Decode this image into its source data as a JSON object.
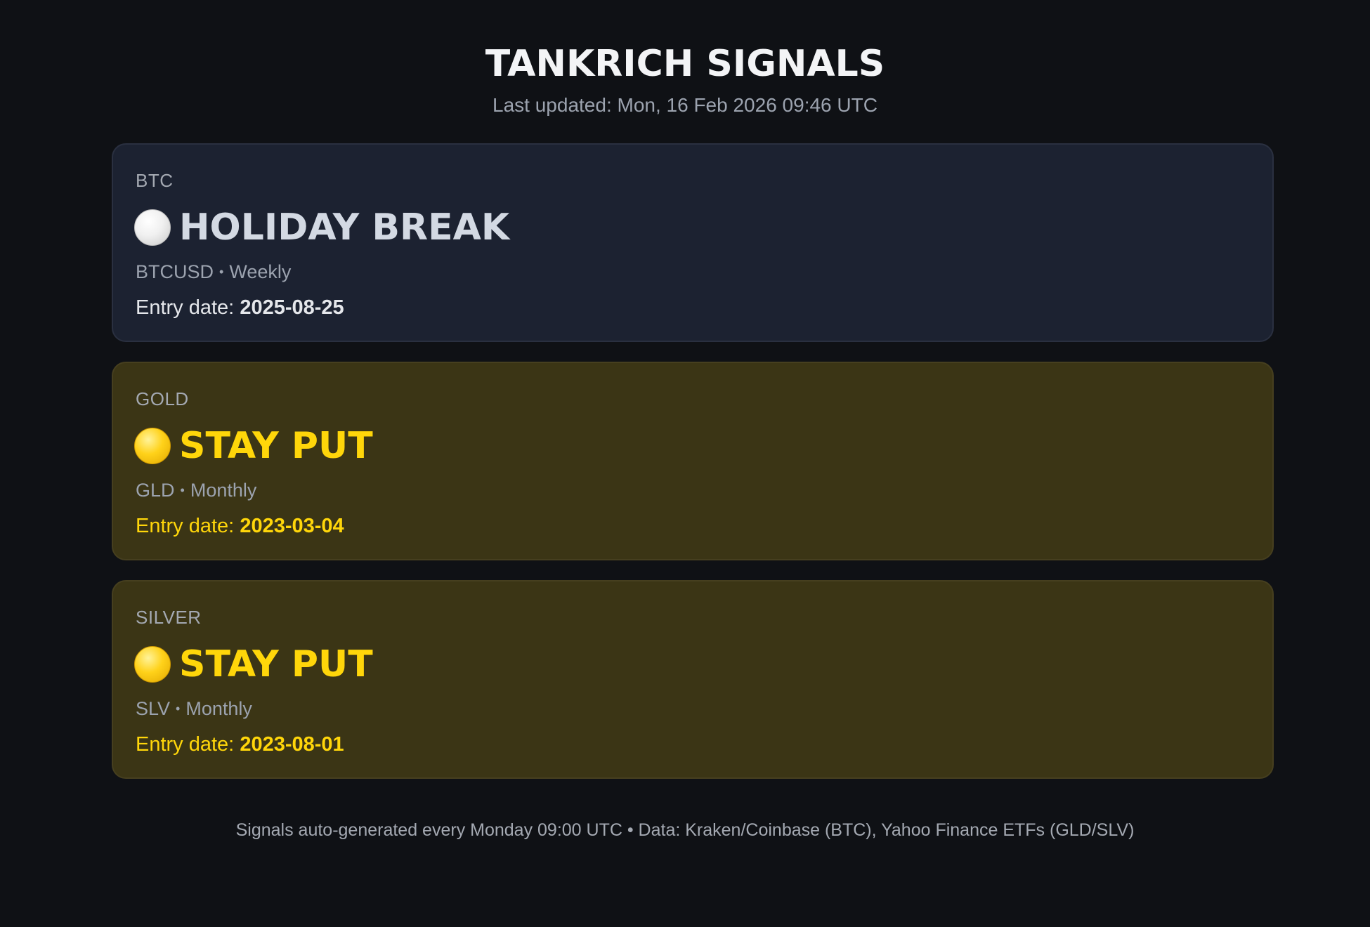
{
  "header": {
    "title": "TANKRICH SIGNALS",
    "updated": "Last updated: Mon, 16 Feb 2026 09:46 UTC"
  },
  "cards": [
    {
      "asset": "BTC",
      "signal": "HOLIDAY BREAK",
      "signal_icon": "white-circle-icon",
      "signal_color": "#d3d9e3",
      "ticker": "BTCUSD",
      "separator": "•",
      "frequency": "Weekly",
      "entry_label": "Entry date: ",
      "entry_date": "2025-08-25"
    },
    {
      "asset": "GOLD",
      "signal": "STAY PUT",
      "signal_icon": "yellow-circle-icon",
      "signal_color": "#ffd60a",
      "ticker": "GLD",
      "separator": "•",
      "frequency": "Monthly",
      "entry_label": "Entry date: ",
      "entry_date": "2023-03-04"
    },
    {
      "asset": "SILVER",
      "signal": "STAY PUT",
      "signal_icon": "yellow-circle-icon",
      "signal_color": "#ffd60a",
      "ticker": "SLV",
      "separator": "•",
      "frequency": "Monthly",
      "entry_label": "Entry date: ",
      "entry_date": "2023-08-01"
    }
  ],
  "footer": {
    "text": "Signals auto-generated every Monday 09:00 UTC • Data: Kraken/Coinbase (BTC), Yahoo Finance ETFs (GLD/SLV)"
  },
  "colors": {
    "background": "#0f1115",
    "neutral_card": "#1c2231",
    "yellow_card": "#3b3515",
    "accent_yellow": "#ffd60a"
  }
}
